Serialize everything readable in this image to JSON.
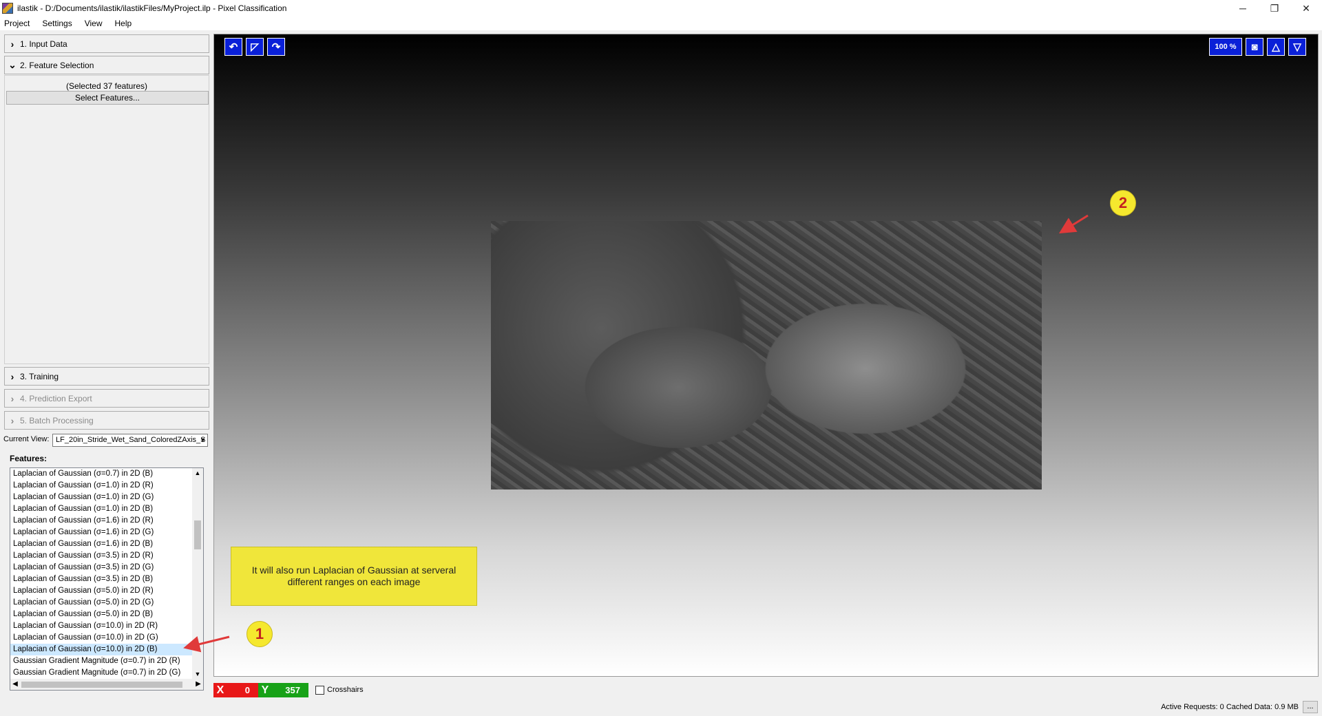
{
  "window": {
    "title": "ilastik - D:/Documents/ilastik/ilastikFiles/MyProject.ilp - Pixel Classification",
    "minimize": "─",
    "restore": "❐",
    "close": "✕"
  },
  "menu": [
    "Project",
    "Settings",
    "View",
    "Help"
  ],
  "applets": {
    "input_data": "1. Input Data",
    "feature_selection": "2. Feature Selection",
    "training": "3. Training",
    "prediction_export": "4. Prediction Export",
    "batch_processing": "5. Batch Processing"
  },
  "feature_selection": {
    "selected_count": "(Selected 37 features)",
    "select_button": "Select Features..."
  },
  "current_view": {
    "label": "Current View:",
    "value": "LF_20in_Stride_Wet_Sand_ColoredZAxis_S"
  },
  "features": {
    "label": "Features:",
    "items": [
      "Laplacian of Gaussian (σ=0.7) in 2D (B)",
      "Laplacian of Gaussian (σ=1.0) in 2D (R)",
      "Laplacian of Gaussian (σ=1.0) in 2D (G)",
      "Laplacian of Gaussian (σ=1.0) in 2D (B)",
      "Laplacian of Gaussian (σ=1.6) in 2D (R)",
      "Laplacian of Gaussian (σ=1.6) in 2D (G)",
      "Laplacian of Gaussian (σ=1.6) in 2D (B)",
      "Laplacian of Gaussian (σ=3.5) in 2D (R)",
      "Laplacian of Gaussian (σ=3.5) in 2D (G)",
      "Laplacian of Gaussian (σ=3.5) in 2D (B)",
      "Laplacian of Gaussian (σ=5.0) in 2D (R)",
      "Laplacian of Gaussian (σ=5.0) in 2D (G)",
      "Laplacian of Gaussian (σ=5.0) in 2D (B)",
      "Laplacian of Gaussian (σ=10.0) in 2D (R)",
      "Laplacian of Gaussian (σ=10.0) in 2D (G)",
      "Laplacian of Gaussian (σ=10.0) in 2D (B)",
      "Gaussian Gradient Magnitude (σ=0.7) in 2D (R)",
      "Gaussian Gradient Magnitude (σ=0.7) in 2D (G)"
    ],
    "selected_item": "Laplacian of Gaussian (σ=10.0) in 2D (B)"
  },
  "viewer": {
    "zoom": "100 %",
    "callout_text": "It will also run Laplacian of Gaussian at serveral different ranges on each image",
    "badge_1": "1",
    "badge_2": "2"
  },
  "coords": {
    "x_label": "X",
    "x_value": "0",
    "y_label": "Y",
    "y_value": "357",
    "crosshairs_label": "Crosshairs"
  },
  "status": {
    "text": "Active Requests: 0  Cached Data: 0.9 MB",
    "more": "..."
  },
  "colors": {
    "tool_blue": "#0a20d8",
    "coord_x_red": "#e81818",
    "coord_y_green": "#18a218",
    "callout_yellow": "#f0e63a",
    "annotation_arrow": "#e03a3a"
  }
}
